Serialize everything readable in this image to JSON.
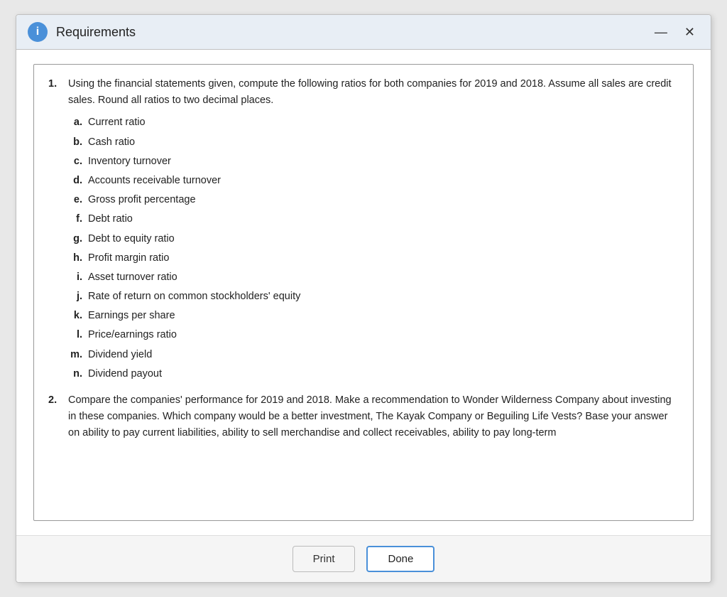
{
  "window": {
    "title": "Requirements",
    "info_icon_label": "i",
    "minimize_label": "—",
    "close_label": "✕"
  },
  "requirements": [
    {
      "number": "1.",
      "intro": "Using the financial statements given, compute the following ratios for both companies for 2019 and 2018. Assume all sales are credit sales. Round all ratios to two decimal places.",
      "sub_items": [
        {
          "letter": "a.",
          "text": "Current ratio"
        },
        {
          "letter": "b.",
          "text": "Cash ratio"
        },
        {
          "letter": "c.",
          "text": "Inventory turnover"
        },
        {
          "letter": "d.",
          "text": "Accounts receivable turnover"
        },
        {
          "letter": "e.",
          "text": "Gross profit percentage"
        },
        {
          "letter": "f.",
          "text": "Debt ratio"
        },
        {
          "letter": "g.",
          "text": "Debt to equity ratio"
        },
        {
          "letter": "h.",
          "text": "Profit margin ratio"
        },
        {
          "letter": "i.",
          "text": "Asset turnover ratio"
        },
        {
          "letter": "j.",
          "text": "Rate of return on common stockholders' equity"
        },
        {
          "letter": "k.",
          "text": "Earnings per share"
        },
        {
          "letter": "l.",
          "text": "Price/earnings ratio"
        },
        {
          "letter": "m.",
          "text": "Dividend yield"
        },
        {
          "letter": "n.",
          "text": "Dividend payout"
        }
      ]
    },
    {
      "number": "2.",
      "intro": "Compare the companies' performance for 2019 and 2018. Make a recommendation to Wonder Wilderness Company about investing in these companies. Which company would be a better investment, The Kayak Company or Beguiling Life Vests? Base your answer on ability to pay current liabilities, ability to sell merchandise and collect receivables, ability to pay long-term",
      "sub_items": []
    }
  ],
  "footer": {
    "print_label": "Print",
    "done_label": "Done"
  }
}
